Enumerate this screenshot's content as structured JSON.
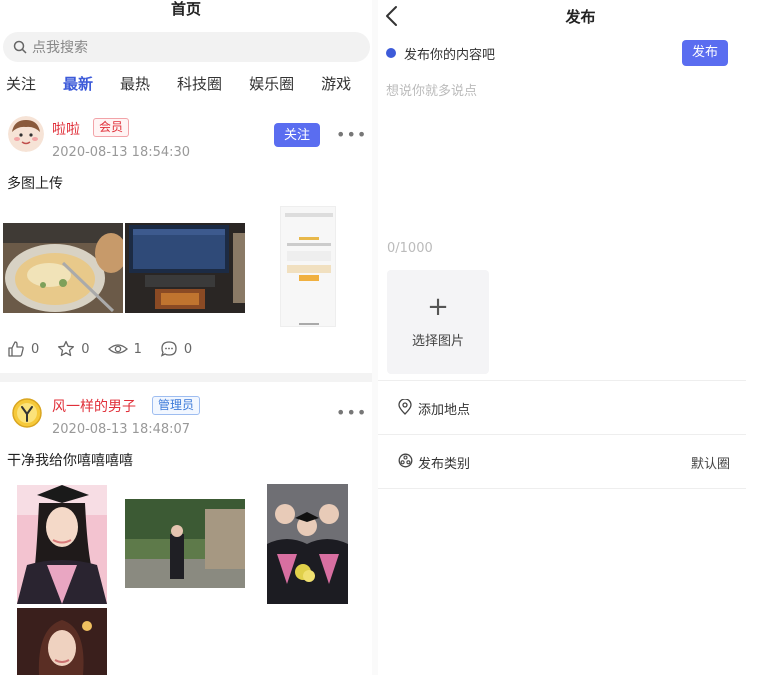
{
  "home": {
    "title": "首页",
    "search_placeholder": "点我搜索",
    "tabs": [
      "关注",
      "最新",
      "最热",
      "科技圈",
      "娱乐圈",
      "游戏"
    ],
    "active_tab": 1,
    "posts": [
      {
        "author": "啦啦",
        "badge": "会员",
        "time": "2020-08-13 18:54:30",
        "follow_label": "关注",
        "content": "多图上传",
        "stats": {
          "likes": "0",
          "favorites": "0",
          "views": "1",
          "comments": "0"
        }
      },
      {
        "author": "风一样的男子",
        "badge": "管理员",
        "time": "2020-08-13 18:48:07",
        "content": "干净我给你嘻嘻嘻嘻"
      }
    ]
  },
  "publish": {
    "title": "发布",
    "prompt": "发布你的内容吧",
    "publish_button": "发布",
    "placeholder": "想说你就多说点",
    "counter": "0/1000",
    "choose_image": "选择图片",
    "add_location": "添加地点",
    "category_label": "发布类别",
    "category_value": "默认圈"
  },
  "colors": {
    "accent": "#5a6df0",
    "tab_active": "#3d5bd9",
    "username": "#e0303a"
  }
}
